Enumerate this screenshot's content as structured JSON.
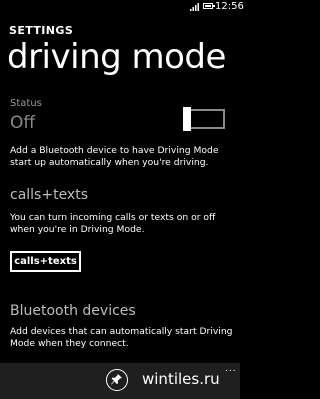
{
  "statusbar": {
    "time": "12:56"
  },
  "header": {
    "label": "SETTINGS",
    "title": "driving mode"
  },
  "status": {
    "caption": "Status",
    "value": "Off"
  },
  "description": "Add a Bluetooth device to have Driving Mode\nstart up automatically when you're driving.",
  "calls_texts": {
    "title": "calls+texts",
    "text": "You can turn incoming calls or texts on or off\nwhen you're in Driving Mode.",
    "button_label": "calls+texts"
  },
  "bluetooth": {
    "title": "Bluetooth devices",
    "text": "Add devices that can automatically start Driving\nMode when they connect."
  },
  "appbar": {
    "ellipsis": "...",
    "icon": "pin-icon",
    "watermark": "wintiles.ru"
  }
}
